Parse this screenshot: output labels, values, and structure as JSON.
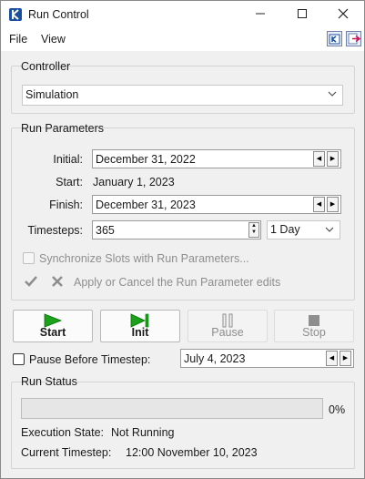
{
  "window": {
    "title": "Run Control",
    "minimize": "—",
    "maximize": "☐",
    "close": "✕"
  },
  "menu": {
    "file": "File",
    "view": "View"
  },
  "controller": {
    "group_title": "Controller",
    "selected": "Simulation"
  },
  "run_parameters": {
    "group_title": "Run Parameters",
    "initial_label": "Initial:",
    "initial_value": "December 31, 2022",
    "start_label": "Start:",
    "start_value": "January 1, 2023",
    "finish_label": "Finish:",
    "finish_value": "December 31, 2023",
    "timesteps_label": "Timesteps:",
    "timesteps_value": "365",
    "timestep_unit": "1 Day",
    "sync_label": "Synchronize Slots with Run Parameters...",
    "apply_cancel_label": "Apply or Cancel the Run Parameter edits"
  },
  "buttons": {
    "start": "Start",
    "init": "Init",
    "pause": "Pause",
    "stop": "Stop"
  },
  "pause_before": {
    "label": "Pause Before Timestep:",
    "value": "July 4, 2023"
  },
  "run_status": {
    "group_title": "Run Status",
    "progress_percent": 0,
    "progress_text": "0%",
    "execution_state_label": "Execution State:",
    "execution_state_value": "Not Running",
    "current_timestep_label": "Current Timestep:",
    "current_timestep_value": "12:00 November 10, 2023"
  },
  "colors": {
    "start_green": "#1aa31a",
    "progress_fill": "#06b025",
    "app_icon": "#1a4fa0"
  },
  "icons": [
    "app-icon",
    "toolbar-help-icon",
    "toolbar-exit-icon",
    "chevron-down-icon",
    "arrow-left-icon",
    "arrow-right-icon",
    "checkmark-icon",
    "x-icon",
    "play-icon",
    "step-icon",
    "pause-icon",
    "stop-icon"
  ]
}
